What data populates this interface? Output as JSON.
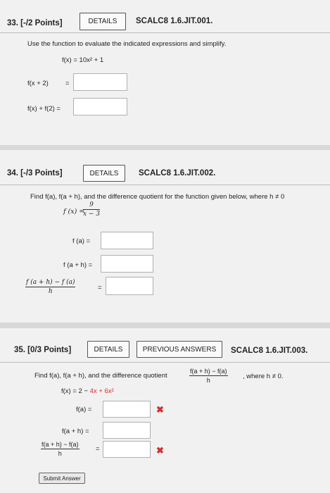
{
  "q33": {
    "header": "33.  [-/2 Points]",
    "details": "DETAILS",
    "code": "SCALC8 1.6.JIT.001.",
    "instruction": "Use the function to evaluate the indicated expressions and simplify.",
    "function": "f(x) = 10x² + 1",
    "row1_label": "f(x + 2)",
    "row2_label": "f(x) + f(2) ="
  },
  "q34": {
    "header": "34.  [-/3 Points]",
    "details": "DETAILS",
    "code": "SCALC8 1.6.JIT.002.",
    "instruction": "Find f(a), f(a + h), and the difference quotient for the function given below, where h ≠ 0",
    "func_lhs": "f (x) =",
    "func_num": "9",
    "func_den": "x − 3",
    "row1_label": "f (a) =",
    "row2_label": "f (a + h) =",
    "dq_num": "f (a + h) − f (a)",
    "dq_den": "h"
  },
  "q35": {
    "header": "35.  [0/3 Points]",
    "details": "DETAILS",
    "previous": "PREVIOUS ANSWERS",
    "code": "SCALC8 1.6.JIT.003.",
    "instruction": "Find f(a), f(a + h), and the difference quotient",
    "dq_num_inline": "f(a + h) − f(a)",
    "dq_den_inline": "h",
    "instruction_end": ", where h ≠ 0.",
    "func_prefix": "f(x) = 2 − ",
    "func_red": "4x + 6x²",
    "row1_label": "f(a) =",
    "row2_label": "f(a + h) =",
    "dq_num": "f(a + h) − f(a)",
    "dq_den": "h",
    "submit": "Submit Answer",
    "wrong_mark": "✖"
  }
}
